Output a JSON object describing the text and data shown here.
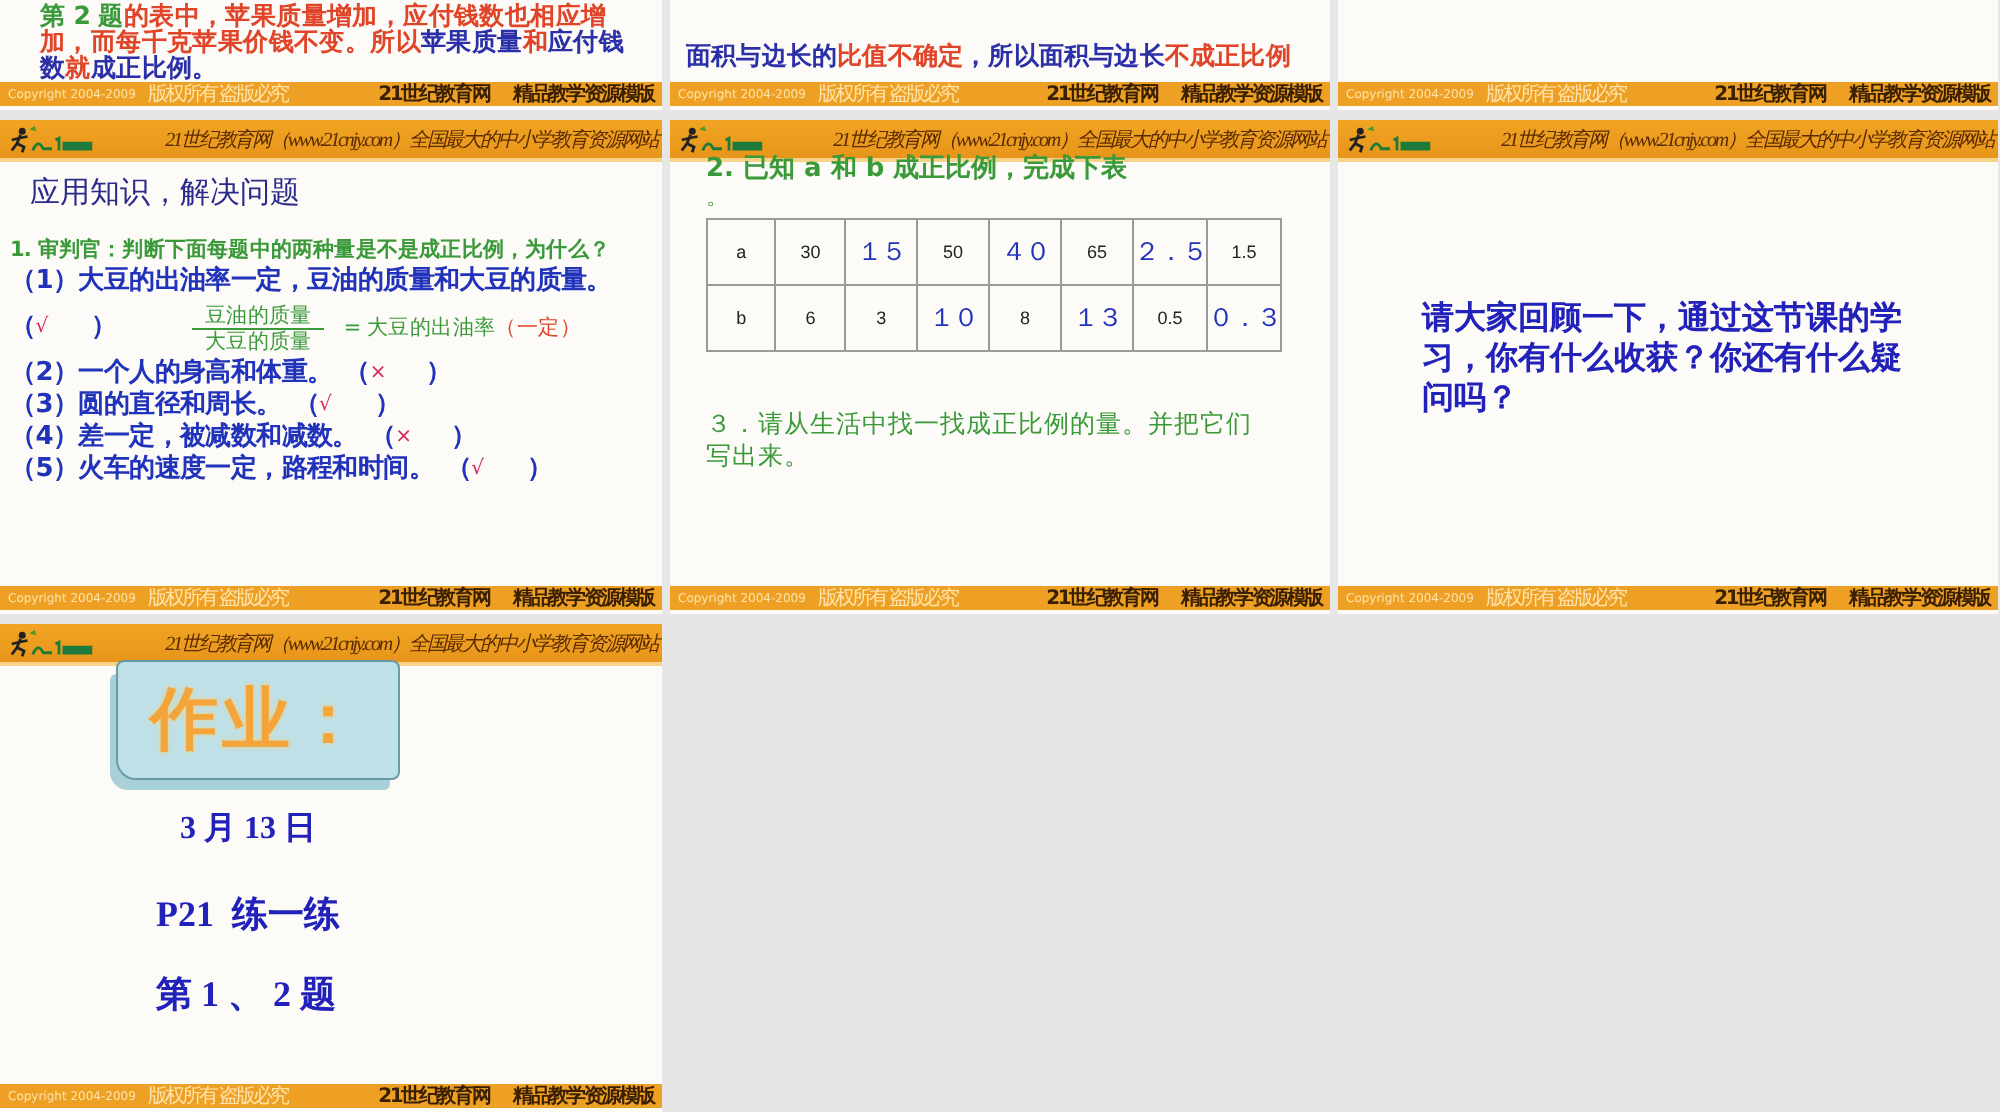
{
  "slides": [
    {
      "kind": "tail",
      "lines": [
        [
          {
            "text": "第 2 题",
            "color": "#3a9a3a"
          },
          {
            "text": "的表中，苹果质量增加，应付钱数也相应增",
            "color": "#e0452a"
          }
        ],
        [
          {
            "text": "加，而每千克苹果价钱不变。所以",
            "color": "#e0452a"
          },
          {
            "text": "苹果质量",
            "color": "#2b2fa8"
          },
          {
            "text": "和",
            "color": "#e0452a"
          },
          {
            "text": "应付钱",
            "color": "#2b2fa8"
          }
        ],
        [
          {
            "text": "数",
            "color": "#2b2fa8"
          },
          {
            "text": "就",
            "color": "#e0452a"
          },
          {
            "text": "成正比例。",
            "color": "#2b2fa8"
          }
        ]
      ],
      "footer": {
        "copyright": "Copyright 2004-2009",
        "rights": "版权所有 盗版必究",
        "site": "21世纪教育网",
        "tagline": "精品教学资源模版"
      }
    },
    {
      "kind": "tail",
      "lines": [
        [
          {
            "text": "面积与边长的",
            "color": "#2b2fa8"
          },
          {
            "text": "比值不确定",
            "color": "#e0452a"
          },
          {
            "text": "，所以面积与边长",
            "color": "#2b2fa8"
          },
          {
            "text": "不成正比例",
            "color": "#e0452a"
          }
        ]
      ],
      "footer": {
        "copyright": "Copyright 2004-2009",
        "rights": "版权所有 盗版必究",
        "site": "21世纪教育网",
        "tagline": "精品教学资源模版"
      }
    },
    {
      "kind": "tail",
      "footer": {
        "copyright": "Copyright 2004-2009",
        "rights": "版权所有 盗版必究",
        "site": "21世纪教育网",
        "tagline": "精品教学资源模版"
      }
    },
    {
      "kind": "questions",
      "header": "21世纪教育网（www.21cnjy.com）全国最大的中小学教育资源网站",
      "title": "应用知识，解决问题",
      "question": "1. 审判官：判断下面每题中的两种量是不是成正比例，为什么？",
      "items": [
        {
          "number": "（1）",
          "text": "大豆的出油率一定，豆油的质量和大豆的质量。",
          "open": "（",
          "mark": "√",
          "close": "）",
          "numerator": "豆油的质量",
          "denominator": "大豆的质量",
          "result": "= 大豆的出油率",
          "note": "（一定）"
        },
        {
          "number": "（2）",
          "text": "一个人的身高和体重。",
          "open": "（",
          "mark": "×",
          "close": "）"
        },
        {
          "number": "（3）",
          "text": "圆的直径和周长。",
          "open": "（",
          "mark": "√",
          "close": "）"
        },
        {
          "number": "（4）",
          "text": "差一定，被减数和减数。",
          "open": "（",
          "mark": "×",
          "close": "）"
        },
        {
          "number": "（5）",
          "text": "火车的速度一定，路程和时间。",
          "open": "（",
          "mark": "√",
          "close": "）"
        }
      ],
      "footer": {
        "copyright": "Copyright 2004-2009",
        "rights": "版权所有 盗版必究",
        "site": "21世纪教育网",
        "tagline": "精品教学资源模版"
      }
    },
    {
      "kind": "table",
      "header": "21世纪教育网（www.21cnjy.com）全国最大的中小学教育资源网站",
      "question": "2. 已知 a 和 b 成正比例，完成下表",
      "question_end": "。",
      "rows": [
        [
          {
            "text": "a",
            "kind": "given"
          },
          {
            "text": "30",
            "kind": "given"
          },
          {
            "text": "１５",
            "kind": "answer"
          },
          {
            "text": "50",
            "kind": "given"
          },
          {
            "text": "４０",
            "kind": "answer"
          },
          {
            "text": "65",
            "kind": "given"
          },
          {
            "text": "２．５",
            "kind": "answer"
          },
          {
            "text": "1.5",
            "kind": "given"
          }
        ],
        [
          {
            "text": "b",
            "kind": "given"
          },
          {
            "text": "6",
            "kind": "given"
          },
          {
            "text": "3",
            "kind": "given"
          },
          {
            "text": "１０",
            "kind": "answer"
          },
          {
            "text": "8",
            "kind": "given"
          },
          {
            "text": "１３",
            "kind": "answer"
          },
          {
            "text": "0.5",
            "kind": "given"
          },
          {
            "text": "０．３",
            "kind": "answer"
          }
        ]
      ],
      "task": "３．请从生活中找一找成正比例的量。并把它们写出来。",
      "footer": {
        "copyright": "Copyright 2004-2009",
        "rights": "版权所有 盗版必究",
        "site": "21世纪教育网",
        "tagline": "精品教学资源模版"
      }
    },
    {
      "kind": "review",
      "header": "21世纪教育网（www.21cnjy.com）全国最大的中小学教育资源网站",
      "text": "请大家回顾一下，通过这节课的学习，你有什么收获？你还有什么疑问吗？",
      "footer": {
        "copyright": "Copyright 2004-2009",
        "rights": "版权所有 盗版必究",
        "site": "21世纪教育网",
        "tagline": "精品教学资源模版"
      }
    },
    {
      "kind": "homework",
      "header": "21世纪教育网（www.21cnjy.com）全国最大的中小学教育资源网站",
      "banner": "作业：",
      "lines": [
        "3 月 13 日",
        "P21  练一练",
        "第 1 、 2 题"
      ],
      "footer": {
        "copyright": "Copyright 2004-2009",
        "rights": "版权所有 盗版必究",
        "site": "21世纪教育网",
        "tagline": "精品教学资源模版"
      }
    }
  ]
}
